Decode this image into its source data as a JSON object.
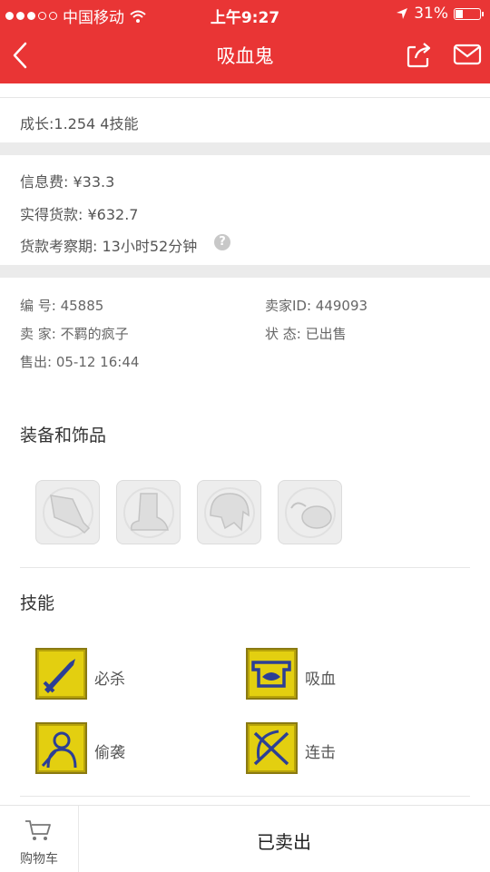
{
  "status_bar": {
    "carrier": "中国移动",
    "time": "上午9:27",
    "battery": "31%"
  },
  "navbar": {
    "title": "吸血鬼"
  },
  "growth": "成长:1.254 4技能",
  "fees": {
    "info_fee": "信息费: ¥33.3",
    "actual_payment": "实得货款: ¥632.7",
    "review_period": "货款考察期: 13小时52分钟",
    "help": "?"
  },
  "details": {
    "number": "编  号: 45885",
    "seller_id": "卖家ID: 449093",
    "seller": "卖  家: 不羁的疯子",
    "status": "状  态: 已出售",
    "sold_time": "售出: 05-12 16:44"
  },
  "equipment": {
    "title": "装备和饰品",
    "slots": [
      "weapon-icon",
      "boot-icon",
      "armor-icon",
      "accessory-icon"
    ]
  },
  "skills": {
    "title": "技能",
    "items": [
      {
        "label": "必杀",
        "icon": "sword-skill-icon"
      },
      {
        "label": "吸血",
        "icon": "bloodsuck-skill-icon"
      },
      {
        "label": "偷袭",
        "icon": "sneak-attack-skill-icon"
      },
      {
        "label": "连击",
        "icon": "combo-skill-icon"
      }
    ]
  },
  "bottom": {
    "cart_label": "购物车",
    "status_button": "已卖出"
  },
  "colors": {
    "brand_red": "#e93535",
    "skill_yellow": "#dcc70a"
  }
}
